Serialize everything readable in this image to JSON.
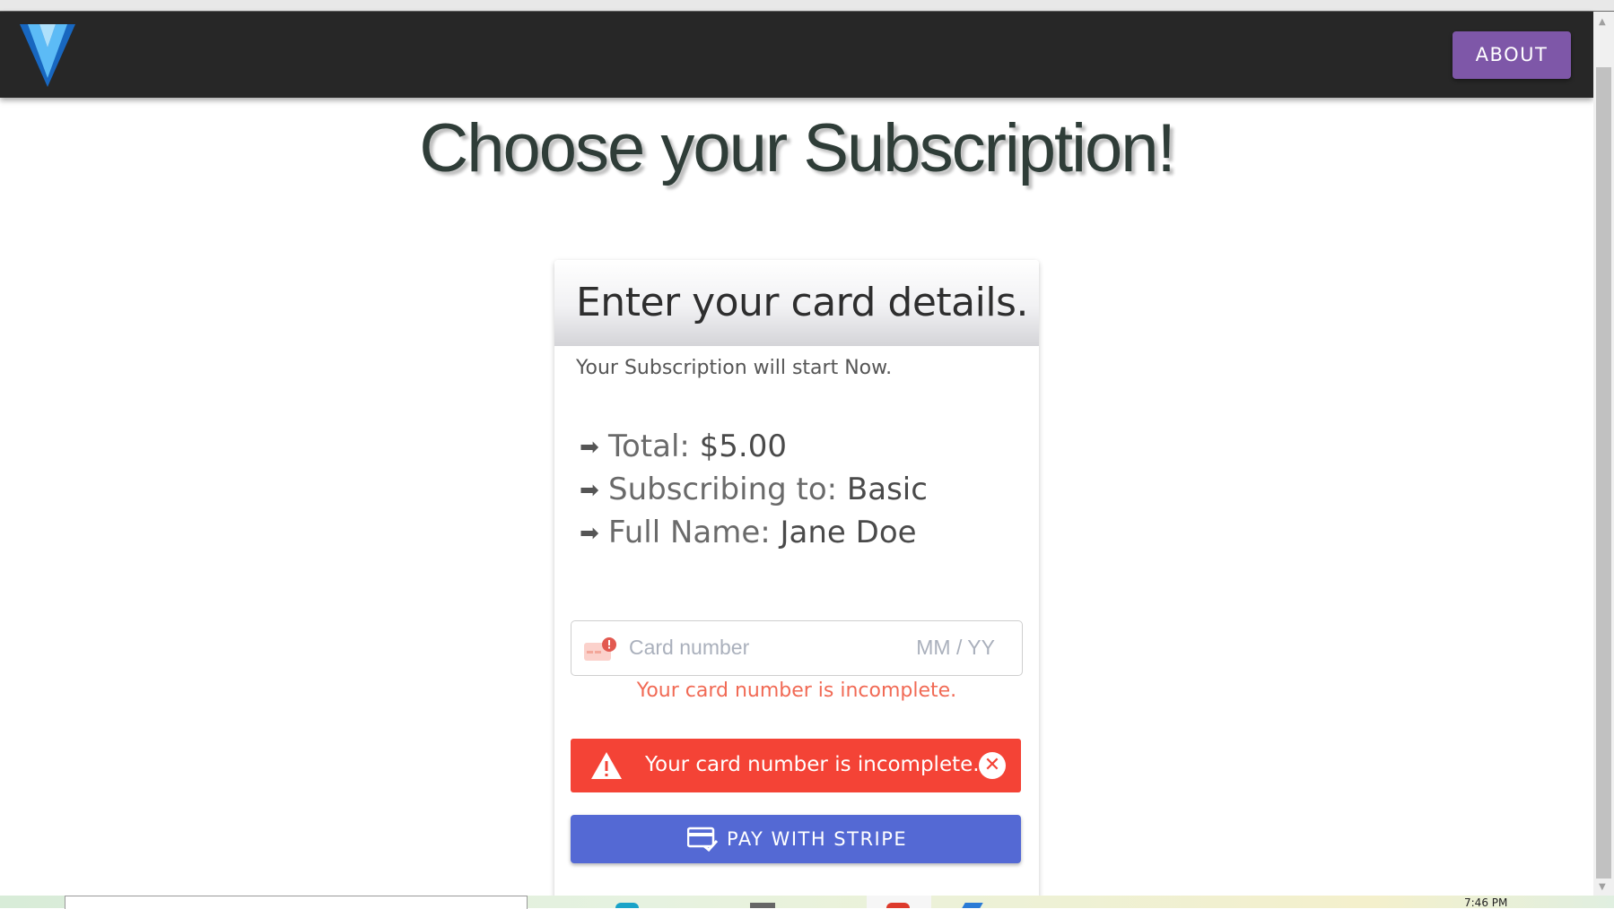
{
  "header": {
    "logo_icon": "vuetify-v-logo-icon",
    "about_label": "ABOUT",
    "background": "#272727",
    "accent": "#7e57a8"
  },
  "page": {
    "title": "Choose your Subscription!"
  },
  "card": {
    "title": "Enter your card details.",
    "subtitle": "Your Subscription will start Now.",
    "details": [
      {
        "icon": "arrow-right-icon",
        "label": "Total: ",
        "value": "$5.00"
      },
      {
        "icon": "arrow-right-icon",
        "label": "Subscribing to: ",
        "value": "Basic"
      },
      {
        "icon": "arrow-right-icon",
        "label": "Full Name: ",
        "value": "Jane Doe"
      }
    ],
    "card_input": {
      "icon": "card-error-icon",
      "card_number_placeholder": "Card number",
      "expiry_placeholder": "MM / YY"
    },
    "inline_error": "Your card number is incomplete.",
    "alert": {
      "icon": "warning-icon",
      "text": "Your card number is incomplete.",
      "close_icon": "close-circle-icon",
      "color": "#f44336"
    },
    "pay_button": {
      "icon": "credit-card-check-icon",
      "label": "PAY WITH STRIPE",
      "color": "#5469d4"
    }
  },
  "taskbar": {
    "clock": "7:46 PM"
  }
}
